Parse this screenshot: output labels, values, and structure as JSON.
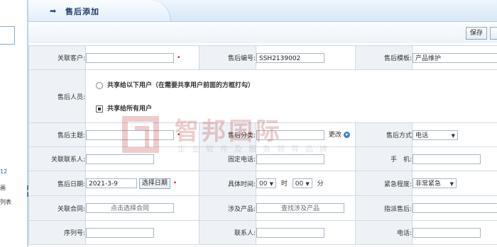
{
  "sidebar": {
    "texts": [
      "12",
      "画",
      "列表"
    ]
  },
  "header": {
    "title": "售后添加"
  },
  "toolbar": {
    "save_label": "保存"
  },
  "form": {
    "customer": {
      "label": "关联客户:",
      "value": ""
    },
    "code": {
      "label": "售后编号:",
      "value": "SSH2139002"
    },
    "template": {
      "label": "售后模板:",
      "value": "产品维护"
    },
    "staff": {
      "label": "售后人员:",
      "share_users": "共享给以下用户（在需要共享用户前面的方框打勾）",
      "share_all": "共享给所有用户"
    },
    "subject": {
      "label": "售后主题:",
      "value": ""
    },
    "category": {
      "label": "售后分类:",
      "value": "",
      "change": "更改"
    },
    "method": {
      "label": "售后方式",
      "value": "电话"
    },
    "contact": {
      "label": "关联联系人:",
      "value": ""
    },
    "phone": {
      "label": "固定电话:",
      "value": ""
    },
    "mobile": {
      "label": "手　机:",
      "value": ""
    },
    "date": {
      "label": "售后日期:",
      "value": "2021-3-9",
      "pick": "选择日期"
    },
    "time": {
      "label": "具体时间:",
      "hour": "00",
      "hour_unit": "时",
      "minute": "00",
      "minute_unit": "分"
    },
    "urgency": {
      "label": "紧急程度:",
      "value": "非常紧急"
    },
    "contract": {
      "label": "关联合同:",
      "placeholder": "点击选择合同"
    },
    "product": {
      "label": "涉及产品:",
      "placeholder": "查找涉及产品"
    },
    "assign": {
      "label": "指派售后:",
      "value": ""
    },
    "serial": {
      "label": "序列号:",
      "value": ""
    },
    "linkman": {
      "label": "联系人:",
      "value": ""
    },
    "tel": {
      "label": "电话:",
      "value": ""
    }
  },
  "watermark": {
    "brand": "智邦国际",
    "slogan": "企业软件及服务领导品牌"
  },
  "colors": {
    "required": "#dd1111",
    "header_text": "#1f3d6b",
    "watermark": "#b31b1b"
  }
}
